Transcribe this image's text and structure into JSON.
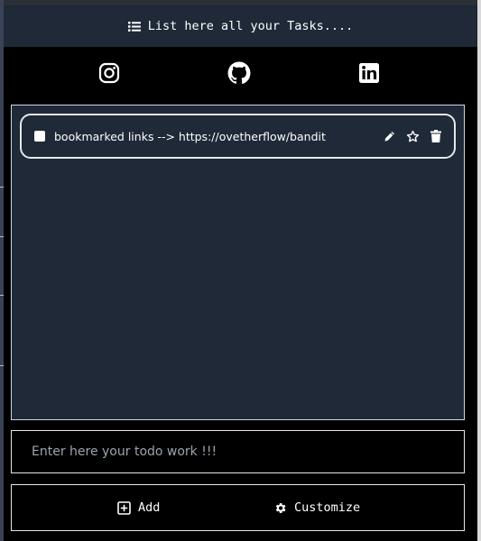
{
  "header": {
    "title": "List here all your Tasks....",
    "icon": "list-icon"
  },
  "social": [
    {
      "name": "instagram",
      "icon": "instagram-icon"
    },
    {
      "name": "github",
      "icon": "github-icon"
    },
    {
      "name": "linkedin",
      "icon": "linkedin-icon"
    }
  ],
  "tasks": [
    {
      "text": "bookmarked links --> https://ovetherflow/bandit",
      "checked": false
    }
  ],
  "input": {
    "placeholder": "Enter here your todo work !!!",
    "value": ""
  },
  "buttons": {
    "add": "Add",
    "customize": "Customize"
  },
  "colors": {
    "panel": "#1f2937",
    "background": "#000000",
    "text": "#ffffff"
  }
}
